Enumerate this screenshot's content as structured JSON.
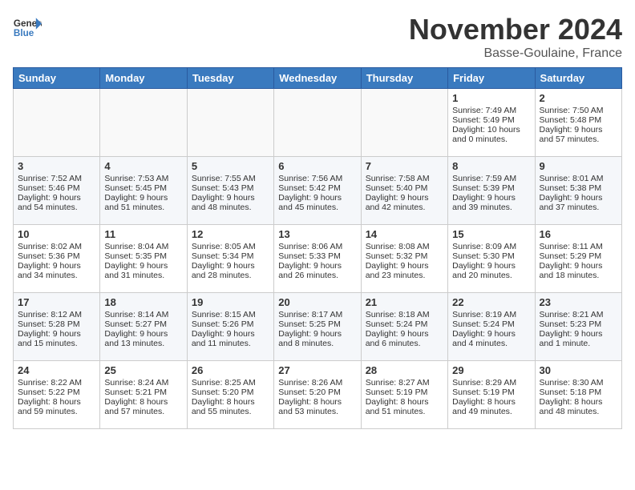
{
  "header": {
    "logo_general": "General",
    "logo_blue": "Blue",
    "month_title": "November 2024",
    "location": "Basse-Goulaine, France"
  },
  "weekdays": [
    "Sunday",
    "Monday",
    "Tuesday",
    "Wednesday",
    "Thursday",
    "Friday",
    "Saturday"
  ],
  "weeks": [
    [
      {
        "day": "",
        "sunrise": "",
        "sunset": "",
        "daylight": ""
      },
      {
        "day": "",
        "sunrise": "",
        "sunset": "",
        "daylight": ""
      },
      {
        "day": "",
        "sunrise": "",
        "sunset": "",
        "daylight": ""
      },
      {
        "day": "",
        "sunrise": "",
        "sunset": "",
        "daylight": ""
      },
      {
        "day": "",
        "sunrise": "",
        "sunset": "",
        "daylight": ""
      },
      {
        "day": "1",
        "sunrise": "Sunrise: 7:49 AM",
        "sunset": "Sunset: 5:49 PM",
        "daylight": "Daylight: 10 hours and 0 minutes."
      },
      {
        "day": "2",
        "sunrise": "Sunrise: 7:50 AM",
        "sunset": "Sunset: 5:48 PM",
        "daylight": "Daylight: 9 hours and 57 minutes."
      }
    ],
    [
      {
        "day": "3",
        "sunrise": "Sunrise: 7:52 AM",
        "sunset": "Sunset: 5:46 PM",
        "daylight": "Daylight: 9 hours and 54 minutes."
      },
      {
        "day": "4",
        "sunrise": "Sunrise: 7:53 AM",
        "sunset": "Sunset: 5:45 PM",
        "daylight": "Daylight: 9 hours and 51 minutes."
      },
      {
        "day": "5",
        "sunrise": "Sunrise: 7:55 AM",
        "sunset": "Sunset: 5:43 PM",
        "daylight": "Daylight: 9 hours and 48 minutes."
      },
      {
        "day": "6",
        "sunrise": "Sunrise: 7:56 AM",
        "sunset": "Sunset: 5:42 PM",
        "daylight": "Daylight: 9 hours and 45 minutes."
      },
      {
        "day": "7",
        "sunrise": "Sunrise: 7:58 AM",
        "sunset": "Sunset: 5:40 PM",
        "daylight": "Daylight: 9 hours and 42 minutes."
      },
      {
        "day": "8",
        "sunrise": "Sunrise: 7:59 AM",
        "sunset": "Sunset: 5:39 PM",
        "daylight": "Daylight: 9 hours and 39 minutes."
      },
      {
        "day": "9",
        "sunrise": "Sunrise: 8:01 AM",
        "sunset": "Sunset: 5:38 PM",
        "daylight": "Daylight: 9 hours and 37 minutes."
      }
    ],
    [
      {
        "day": "10",
        "sunrise": "Sunrise: 8:02 AM",
        "sunset": "Sunset: 5:36 PM",
        "daylight": "Daylight: 9 hours and 34 minutes."
      },
      {
        "day": "11",
        "sunrise": "Sunrise: 8:04 AM",
        "sunset": "Sunset: 5:35 PM",
        "daylight": "Daylight: 9 hours and 31 minutes."
      },
      {
        "day": "12",
        "sunrise": "Sunrise: 8:05 AM",
        "sunset": "Sunset: 5:34 PM",
        "daylight": "Daylight: 9 hours and 28 minutes."
      },
      {
        "day": "13",
        "sunrise": "Sunrise: 8:06 AM",
        "sunset": "Sunset: 5:33 PM",
        "daylight": "Daylight: 9 hours and 26 minutes."
      },
      {
        "day": "14",
        "sunrise": "Sunrise: 8:08 AM",
        "sunset": "Sunset: 5:32 PM",
        "daylight": "Daylight: 9 hours and 23 minutes."
      },
      {
        "day": "15",
        "sunrise": "Sunrise: 8:09 AM",
        "sunset": "Sunset: 5:30 PM",
        "daylight": "Daylight: 9 hours and 20 minutes."
      },
      {
        "day": "16",
        "sunrise": "Sunrise: 8:11 AM",
        "sunset": "Sunset: 5:29 PM",
        "daylight": "Daylight: 9 hours and 18 minutes."
      }
    ],
    [
      {
        "day": "17",
        "sunrise": "Sunrise: 8:12 AM",
        "sunset": "Sunset: 5:28 PM",
        "daylight": "Daylight: 9 hours and 15 minutes."
      },
      {
        "day": "18",
        "sunrise": "Sunrise: 8:14 AM",
        "sunset": "Sunset: 5:27 PM",
        "daylight": "Daylight: 9 hours and 13 minutes."
      },
      {
        "day": "19",
        "sunrise": "Sunrise: 8:15 AM",
        "sunset": "Sunset: 5:26 PM",
        "daylight": "Daylight: 9 hours and 11 minutes."
      },
      {
        "day": "20",
        "sunrise": "Sunrise: 8:17 AM",
        "sunset": "Sunset: 5:25 PM",
        "daylight": "Daylight: 9 hours and 8 minutes."
      },
      {
        "day": "21",
        "sunrise": "Sunrise: 8:18 AM",
        "sunset": "Sunset: 5:24 PM",
        "daylight": "Daylight: 9 hours and 6 minutes."
      },
      {
        "day": "22",
        "sunrise": "Sunrise: 8:19 AM",
        "sunset": "Sunset: 5:24 PM",
        "daylight": "Daylight: 9 hours and 4 minutes."
      },
      {
        "day": "23",
        "sunrise": "Sunrise: 8:21 AM",
        "sunset": "Sunset: 5:23 PM",
        "daylight": "Daylight: 9 hours and 1 minute."
      }
    ],
    [
      {
        "day": "24",
        "sunrise": "Sunrise: 8:22 AM",
        "sunset": "Sunset: 5:22 PM",
        "daylight": "Daylight: 8 hours and 59 minutes."
      },
      {
        "day": "25",
        "sunrise": "Sunrise: 8:24 AM",
        "sunset": "Sunset: 5:21 PM",
        "daylight": "Daylight: 8 hours and 57 minutes."
      },
      {
        "day": "26",
        "sunrise": "Sunrise: 8:25 AM",
        "sunset": "Sunset: 5:20 PM",
        "daylight": "Daylight: 8 hours and 55 minutes."
      },
      {
        "day": "27",
        "sunrise": "Sunrise: 8:26 AM",
        "sunset": "Sunset: 5:20 PM",
        "daylight": "Daylight: 8 hours and 53 minutes."
      },
      {
        "day": "28",
        "sunrise": "Sunrise: 8:27 AM",
        "sunset": "Sunset: 5:19 PM",
        "daylight": "Daylight: 8 hours and 51 minutes."
      },
      {
        "day": "29",
        "sunrise": "Sunrise: 8:29 AM",
        "sunset": "Sunset: 5:19 PM",
        "daylight": "Daylight: 8 hours and 49 minutes."
      },
      {
        "day": "30",
        "sunrise": "Sunrise: 8:30 AM",
        "sunset": "Sunset: 5:18 PM",
        "daylight": "Daylight: 8 hours and 48 minutes."
      }
    ]
  ]
}
